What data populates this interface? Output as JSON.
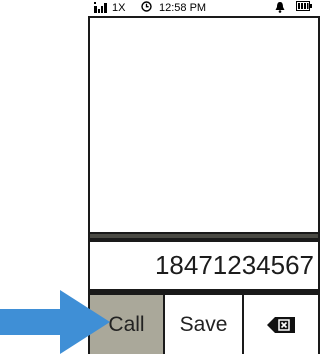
{
  "status_bar": {
    "network": "1X",
    "time": "12:58 PM",
    "icons": [
      "signal-icon",
      "clock-icon",
      "ringer-icon",
      "battery-icon"
    ]
  },
  "dialer": {
    "number": "18471234567"
  },
  "softkeys": {
    "call_label": "Call",
    "save_label": "Save",
    "backspace_icon": "backspace-icon"
  },
  "colors": {
    "arrow": "#3f8fd6",
    "call_button_bg": "#aaa89a",
    "bezel": "#1a1a1a"
  }
}
